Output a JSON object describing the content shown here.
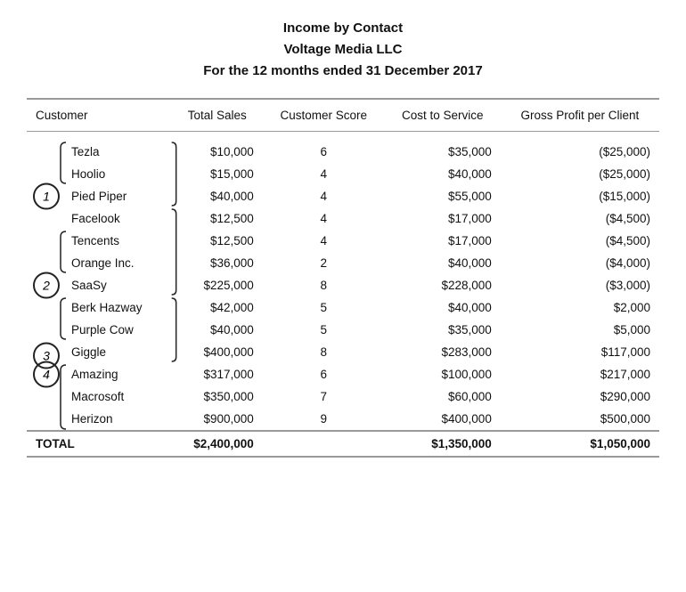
{
  "header": {
    "line1": "Income by Contact",
    "line2": "Voltage Media LLC",
    "line3": "For the 12 months ended 31 December 2017"
  },
  "columns": {
    "customer": "Customer",
    "total_sales": "Total Sales",
    "customer_score": "Customer Score",
    "cost_to_service": "Cost to Service",
    "gross_profit": "Gross Profit per Client"
  },
  "rows": [
    {
      "customer": "Tezla",
      "total_sales": "$10,000",
      "customer_score": "6",
      "cost_to_service": "$35,000",
      "gross_profit": "($25,000)"
    },
    {
      "customer": "Hoolio",
      "total_sales": "$15,000",
      "customer_score": "4",
      "cost_to_service": "$40,000",
      "gross_profit": "($25,000)"
    },
    {
      "customer": "Pied Piper",
      "total_sales": "$40,000",
      "customer_score": "4",
      "cost_to_service": "$55,000",
      "gross_profit": "($15,000)"
    },
    {
      "customer": "Facelook",
      "total_sales": "$12,500",
      "customer_score": "4",
      "cost_to_service": "$17,000",
      "gross_profit": "($4,500)"
    },
    {
      "customer": "Tencents",
      "total_sales": "$12,500",
      "customer_score": "4",
      "cost_to_service": "$17,000",
      "gross_profit": "($4,500)"
    },
    {
      "customer": "Orange Inc.",
      "total_sales": "$36,000",
      "customer_score": "2",
      "cost_to_service": "$40,000",
      "gross_profit": "($4,000)"
    },
    {
      "customer": "SaaSy",
      "total_sales": "$225,000",
      "customer_score": "8",
      "cost_to_service": "$228,000",
      "gross_profit": "($3,000)"
    },
    {
      "customer": "Berk Hazway",
      "total_sales": "$42,000",
      "customer_score": "5",
      "cost_to_service": "$40,000",
      "gross_profit": "$2,000"
    },
    {
      "customer": "Purple Cow",
      "total_sales": "$40,000",
      "customer_score": "5",
      "cost_to_service": "$35,000",
      "gross_profit": "$5,000"
    },
    {
      "customer": "Giggle",
      "total_sales": "$400,000",
      "customer_score": "8",
      "cost_to_service": "$283,000",
      "gross_profit": "$117,000"
    },
    {
      "customer": "Amazing",
      "total_sales": "$317,000",
      "customer_score": "6",
      "cost_to_service": "$100,000",
      "gross_profit": "$217,000"
    },
    {
      "customer": "Macrosoft",
      "total_sales": "$350,000",
      "customer_score": "7",
      "cost_to_service": "$60,000",
      "gross_profit": "$290,000"
    },
    {
      "customer": "Herizon",
      "total_sales": "$900,000",
      "customer_score": "9",
      "cost_to_service": "$400,000",
      "gross_profit": "$500,000"
    }
  ],
  "total": {
    "label": "TOTAL",
    "total_sales": "$2,400,000",
    "customer_score": "",
    "cost_to_service": "$1,350,000",
    "gross_profit": "$1,050,000"
  }
}
